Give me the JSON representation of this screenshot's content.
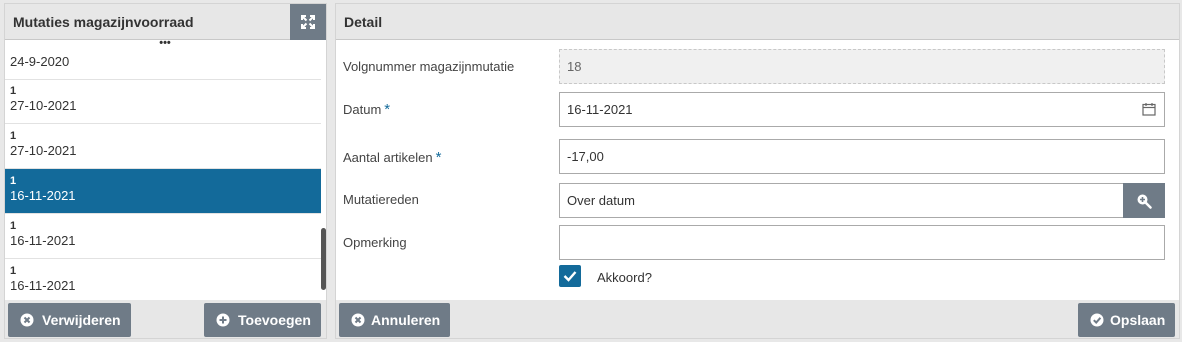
{
  "left": {
    "title": "Mutaties magazijnvoorraad",
    "more_indicator": "•••",
    "items": [
      {
        "num": "",
        "date": "24-9-2020"
      },
      {
        "num": "1",
        "date": "27-10-2021"
      },
      {
        "num": "1",
        "date": "27-10-2021"
      },
      {
        "num": "1",
        "date": "16-11-2021"
      },
      {
        "num": "1",
        "date": "16-11-2021"
      },
      {
        "num": "1",
        "date": "16-11-2021"
      }
    ],
    "selected_index": 3,
    "delete_label": "Verwijderen",
    "add_label": "Toevoegen"
  },
  "detail": {
    "title": "Detail",
    "fields": {
      "volgnummer": {
        "label": "Volgnummer magazijnmutatie",
        "value": "18"
      },
      "datum": {
        "label": "Datum",
        "value": "16-11-2021",
        "required": "*"
      },
      "aantal": {
        "label": "Aantal artikelen",
        "value": "-17,00",
        "required": "*"
      },
      "mutatiereden": {
        "label": "Mutatiereden",
        "value": "Over datum"
      },
      "opmerking": {
        "label": "Opmerking",
        "value": ""
      }
    },
    "akkoord": {
      "label": "Akkoord?",
      "checked": true
    },
    "cancel_label": "Annuleren",
    "save_label": "Opslaan"
  },
  "colors": {
    "accent": "#136a9a",
    "button": "#6f7b87",
    "header": "#e7e7e7"
  },
  "icons": [
    "expand-icon",
    "calendar-icon",
    "zoom-icon",
    "times-circle-icon",
    "plus-circle-icon",
    "check-circle-icon",
    "check-icon"
  ]
}
